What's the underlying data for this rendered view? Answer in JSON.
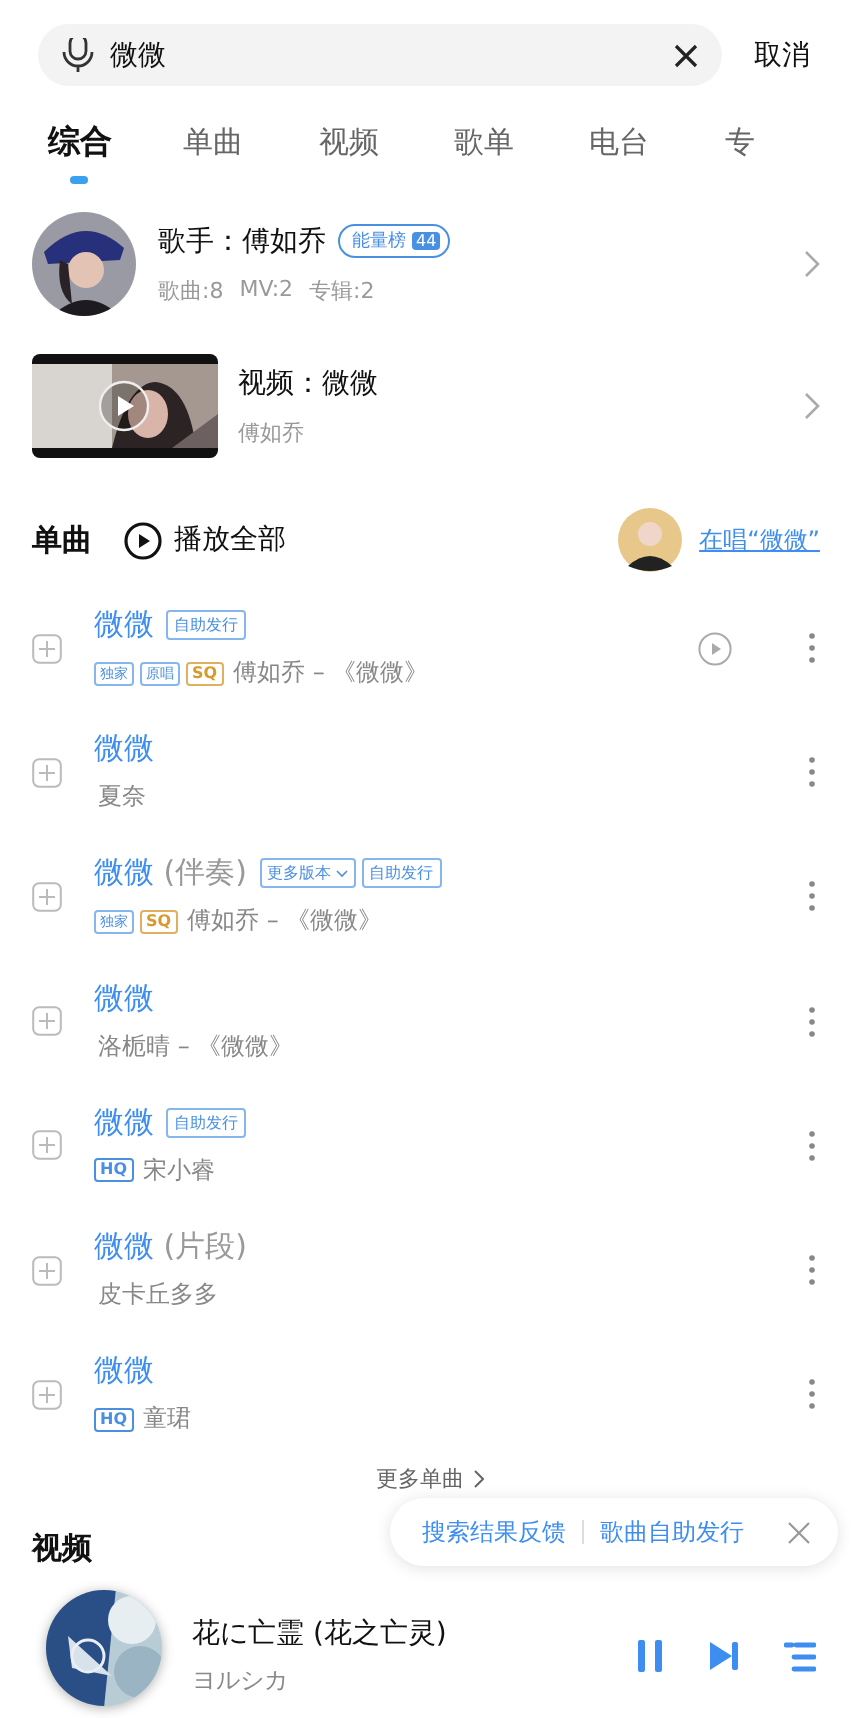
{
  "search": {
    "value": "微微",
    "cancel": "取消"
  },
  "tabs": [
    {
      "label": "综合",
      "selected": true
    },
    {
      "label": "单曲",
      "selected": false
    },
    {
      "label": "视频",
      "selected": false
    },
    {
      "label": "歌单",
      "selected": false
    },
    {
      "label": "电台",
      "selected": false
    },
    {
      "label": "专",
      "selected": false
    }
  ],
  "artist": {
    "title": "歌手：傅如乔",
    "badge": "能量榜",
    "badge_rank": "44",
    "stats": [
      "歌曲:8",
      "MV:2",
      "专辑:2"
    ]
  },
  "video": {
    "title": "视频：微微",
    "artist": "傅如乔"
  },
  "songs_header": {
    "title": "单曲",
    "play_all": "播放全部",
    "singing_link": "在唱“微微”"
  },
  "songs": [
    {
      "title": "微微",
      "badges": [
        {
          "label": "自助发行",
          "kind": "plain"
        }
      ],
      "tags": [
        {
          "label": "独家",
          "kind": "tag"
        },
        {
          "label": "原唱",
          "kind": "tag"
        },
        {
          "label": "SQ",
          "kind": "sq"
        }
      ],
      "subtitle": "傅如乔 – 《微微》",
      "has_video": true
    },
    {
      "title": "微微",
      "subtitle": "夏奈",
      "has_video": false
    },
    {
      "title": "微微",
      "suffix": "(伴奏)",
      "badges": [
        {
          "label": "更多版本",
          "kind": "dropdown"
        },
        {
          "label": "自助发行",
          "kind": "plain"
        }
      ],
      "tags": [
        {
          "label": "独家",
          "kind": "tag"
        },
        {
          "label": "SQ",
          "kind": "sq"
        }
      ],
      "subtitle": "傅如乔 – 《微微》",
      "has_video": false
    },
    {
      "title": "微微",
      "subtitle": "洛栀晴 – 《微微》",
      "has_video": false
    },
    {
      "title": "微微",
      "badges": [
        {
          "label": "自助发行",
          "kind": "plain"
        }
      ],
      "tags": [
        {
          "label": "HQ",
          "kind": "hq"
        }
      ],
      "subtitle": "宋小睿",
      "has_video": false
    },
    {
      "title": "微微",
      "suffix": "(片段)",
      "subtitle": "皮卡丘多多",
      "has_video": false
    },
    {
      "title": "微微",
      "tags": [
        {
          "label": "HQ",
          "kind": "hq"
        }
      ],
      "subtitle": "童珺",
      "has_video": false
    }
  ],
  "more_songs": "更多单曲",
  "feedback": {
    "links": [
      "搜索结果反馈",
      "歌曲自助发行"
    ]
  },
  "next_section": "视频",
  "player": {
    "title": "花に亡霊 (花之亡灵)",
    "artist": "ヨルシカ"
  }
}
